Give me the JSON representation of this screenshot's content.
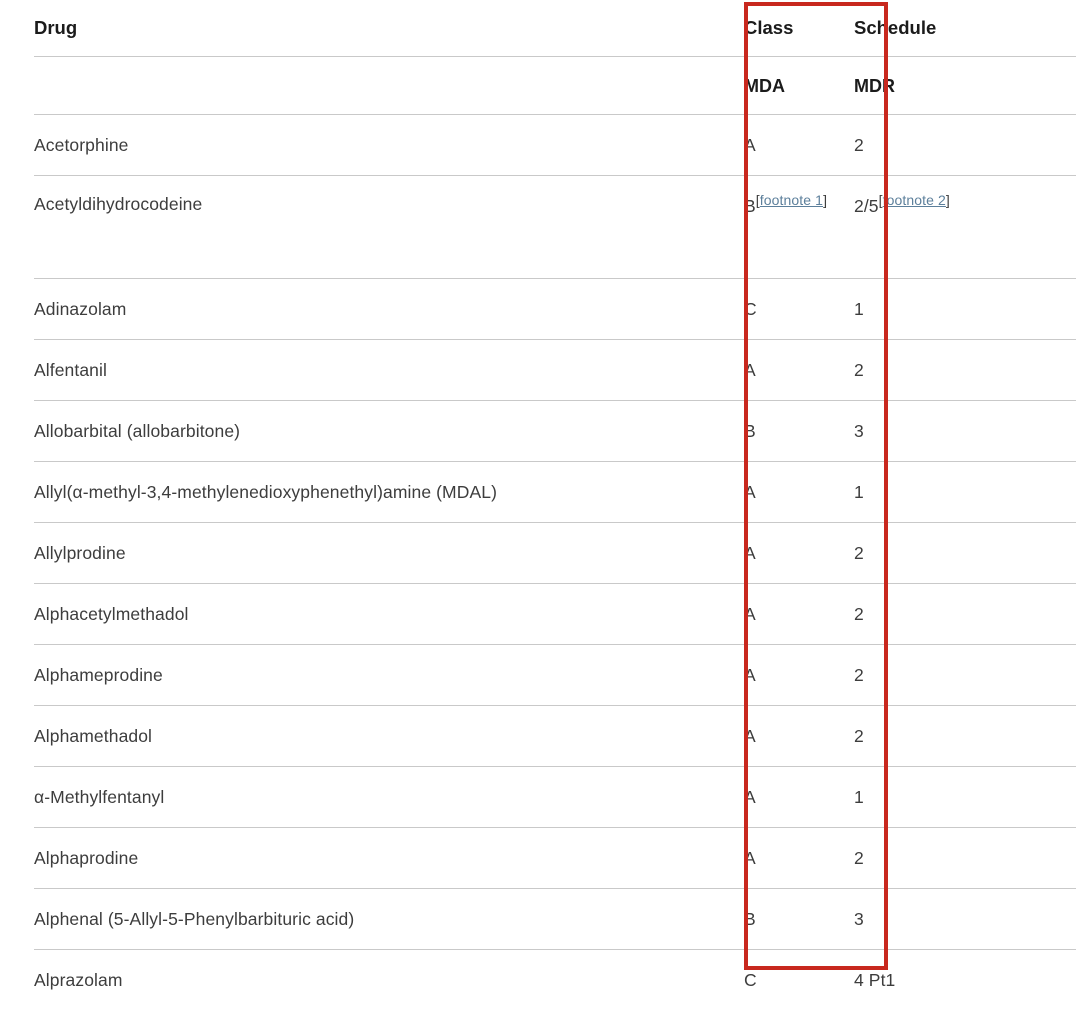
{
  "table": {
    "headers_row1": {
      "drug": "Drug",
      "class": "Class",
      "schedule": "Schedule"
    },
    "headers_row2": {
      "drug": "",
      "class": "MDA",
      "schedule": "MDR"
    },
    "rows": [
      {
        "drug": "Acetorphine",
        "class": "A",
        "class_footnote": "",
        "schedule": "2",
        "schedule_footnote": ""
      },
      {
        "drug": "Acetyldihydrocodeine",
        "class": "B",
        "class_footnote": "footnote 1",
        "schedule": "2/5",
        "schedule_footnote": "footnote 2"
      },
      {
        "drug": "Adinazolam",
        "class": "C",
        "class_footnote": "",
        "schedule": "1",
        "schedule_footnote": ""
      },
      {
        "drug": "Alfentanil",
        "class": "A",
        "class_footnote": "",
        "schedule": "2",
        "schedule_footnote": ""
      },
      {
        "drug": "Allobarbital (allobarbitone)",
        "class": "B",
        "class_footnote": "",
        "schedule": "3",
        "schedule_footnote": ""
      },
      {
        "drug": "Allyl(α-methyl-3,4-methylenedioxyphenethyl)amine (MDAL)",
        "class": "A",
        "class_footnote": "",
        "schedule": "1",
        "schedule_footnote": ""
      },
      {
        "drug": "Allylprodine",
        "class": "A",
        "class_footnote": "",
        "schedule": "2",
        "schedule_footnote": ""
      },
      {
        "drug": "Alphacetylmethadol",
        "class": "A",
        "class_footnote": "",
        "schedule": "2",
        "schedule_footnote": ""
      },
      {
        "drug": "Alphameprodine",
        "class": "A",
        "class_footnote": "",
        "schedule": "2",
        "schedule_footnote": ""
      },
      {
        "drug": "Alphamethadol",
        "class": "A",
        "class_footnote": "",
        "schedule": "2",
        "schedule_footnote": ""
      },
      {
        "drug": "α-Methylfentanyl",
        "class": "A",
        "class_footnote": "",
        "schedule": "1",
        "schedule_footnote": ""
      },
      {
        "drug": "Alphaprodine",
        "class": "A",
        "class_footnote": "",
        "schedule": "2",
        "schedule_footnote": ""
      },
      {
        "drug": "Alphenal (5-Allyl-5-Phenylbarbituric acid)",
        "class": "B",
        "class_footnote": "",
        "schedule": "3",
        "schedule_footnote": ""
      },
      {
        "drug": "Alprazolam",
        "class": "C",
        "class_footnote": "",
        "schedule": "4 Pt1",
        "schedule_footnote": ""
      }
    ]
  },
  "annotation": {
    "highlight_color": "#c8281e",
    "highlighted_column": "Class"
  },
  "colors": {
    "text": "#3d3d3d",
    "header_text": "#1b1b1b",
    "divider": "#c9c9c9",
    "link": "#5c7f9b",
    "background": "#ffffff"
  }
}
